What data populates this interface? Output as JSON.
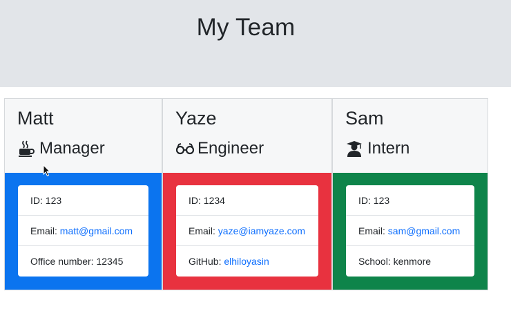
{
  "page": {
    "title": "My Team"
  },
  "colors": {
    "manager": "#0b74ef",
    "engineer": "#e8323f",
    "intern": "#0e844a",
    "link": "#0d6efd"
  },
  "team": [
    {
      "name": "Matt",
      "role": "Manager",
      "icon": "coffee-mug-icon",
      "details": [
        {
          "label": "ID: ",
          "value": "123",
          "link": false
        },
        {
          "label": "Email: ",
          "value": "matt@gmail.com",
          "link": true
        },
        {
          "label": "Office number: ",
          "value": "12345",
          "link": false
        }
      ]
    },
    {
      "name": "Yaze",
      "role": "Engineer",
      "icon": "glasses-icon",
      "details": [
        {
          "label": "ID: ",
          "value": "1234",
          "link": false
        },
        {
          "label": "Email: ",
          "value": "yaze@iamyaze.com",
          "link": true
        },
        {
          "label": "GitHub: ",
          "value": "elhiloyasin",
          "link": true
        }
      ]
    },
    {
      "name": "Sam",
      "role": "Intern",
      "icon": "graduate-icon",
      "details": [
        {
          "label": "ID: ",
          "value": "123",
          "link": false
        },
        {
          "label": "Email: ",
          "value": "sam@gmail.com",
          "link": true
        },
        {
          "label": "School: ",
          "value": "kenmore",
          "link": false
        }
      ]
    }
  ]
}
